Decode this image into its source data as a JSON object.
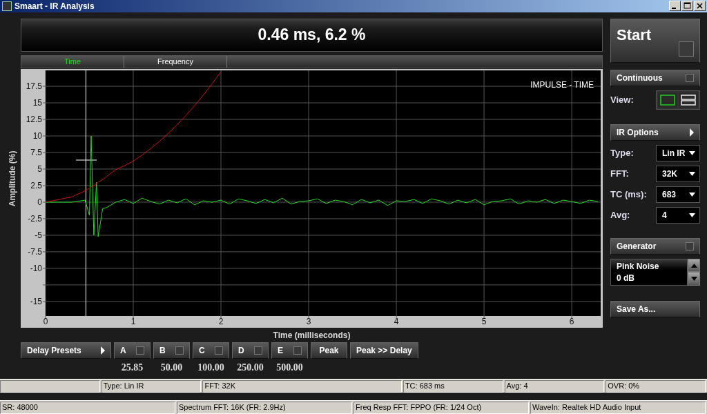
{
  "window": {
    "title": "Smaart - IR Analysis"
  },
  "readout": "0.46 ms, 6.2 %",
  "tabs": [
    {
      "label": "Time",
      "selected": true
    },
    {
      "label": "Frequency",
      "selected": false
    }
  ],
  "plot": {
    "chart_data": {
      "type": "line",
      "title": "IMPULSE - TIME",
      "xlabel": "Time (milliseconds)",
      "ylabel": "Amplitude (%)",
      "x": [
        0,
        0.3,
        0.45,
        0.5,
        0.52,
        0.55,
        0.58,
        0.6,
        0.65,
        0.7,
        0.8,
        0.9,
        1,
        1.1,
        1.2,
        1.3,
        1.4,
        1.5,
        1.6,
        1.7,
        1.8,
        1.9,
        2,
        2.1,
        2.2,
        2.3,
        2.4,
        2.5,
        2.6,
        2.7,
        2.8,
        2.9,
        3,
        3.1,
        3.2,
        3.3,
        3.4,
        3.5,
        3.6,
        3.7,
        3.8,
        3.9,
        4,
        4.1,
        4.2,
        4.3,
        4.4,
        4.5,
        4.6,
        4.7,
        4.8,
        4.9,
        5,
        5.1,
        5.2,
        5.3,
        5.4,
        5.5,
        5.6,
        5.7,
        5.8,
        5.9,
        6,
        6.1,
        6.2,
        6.3
      ],
      "series": [
        {
          "color": "#22dd22",
          "values": [
            0,
            0,
            0.3,
            -2,
            10,
            -5,
            3,
            -5.2,
            -1,
            -0.8,
            0,
            0.4,
            -0.2,
            0.6,
            0.1,
            -0.3,
            0.3,
            -0.1,
            0.5,
            -0.4,
            0.2,
            0,
            0.3,
            -0.3,
            0.5,
            0.2,
            -0.2,
            0.4,
            -0.1,
            0.6,
            -0.3,
            0.1,
            0.2,
            0.5,
            -0.2,
            0.3,
            0.1,
            -0.4,
            0.4,
            -0.1,
            0.3,
            -0.5,
            0.2,
            0.1,
            0.4,
            -0.2,
            0.5,
            0.2,
            -0.3,
            0.3,
            -0.1,
            0.4,
            -0.4,
            0.1,
            0.2,
            0.5,
            -0.3,
            0.2,
            0,
            0.4,
            -0.2,
            0.3,
            0.1,
            -0.2,
            0.3,
            0.1
          ]
        },
        {
          "color": "#cc1111",
          "values": [
            0,
            0.8,
            1.7,
            2.1,
            2.3,
            2.5,
            2.8,
            3,
            3.4,
            3.9,
            4.9,
            5.5,
            6.2,
            7.1,
            8.1,
            9.2,
            10.4,
            11.7,
            13.1,
            14.6,
            16.2,
            17.9,
            19.7,
            null,
            null,
            null,
            null,
            null,
            null,
            null,
            null,
            null,
            null,
            null,
            null,
            null,
            null,
            null,
            null,
            null,
            null,
            null,
            null,
            null,
            null,
            null,
            null,
            null,
            null,
            null,
            null,
            null,
            null,
            null,
            null,
            null,
            null,
            null,
            null,
            null,
            null,
            null,
            null,
            null,
            null,
            null
          ]
        }
      ],
      "xlim": [
        0,
        6.33
      ],
      "ylim": [
        -17.2,
        19.9
      ],
      "xticks": [
        0,
        1,
        2,
        3,
        4,
        5,
        6
      ],
      "yticks": [
        17.5,
        15,
        12.5,
        10,
        7.5,
        5,
        2.5,
        0,
        -2.5,
        -5,
        -7.5,
        -10,
        -15
      ],
      "grid": true,
      "ref_lines": [
        {
          "axis": "x",
          "value": 0.46
        }
      ]
    }
  },
  "side": {
    "start": {
      "label": "Start",
      "checked": false
    },
    "continuous": {
      "label": "Continuous",
      "checked": false
    },
    "view": {
      "label": "View:",
      "options": [
        {
          "kind": "single",
          "selected": true
        },
        {
          "kind": "split",
          "selected": false
        }
      ]
    },
    "ir_options": "IR Options",
    "settings": [
      {
        "label": "Type:",
        "value": "Lin IR"
      },
      {
        "label": "FFT:",
        "value": "32K"
      },
      {
        "label": "TC (ms):",
        "value": "683"
      },
      {
        "label": "Avg:",
        "value": "4"
      }
    ],
    "generator": {
      "label": "Generator",
      "checked": false
    },
    "signal": [
      "Pink Noise",
      "0 dB"
    ],
    "save": "Save As..."
  },
  "delay": {
    "presets": "Delay Presets",
    "slots": [
      {
        "label": "A",
        "checked": false,
        "value": "25.85"
      },
      {
        "label": "B",
        "checked": false,
        "value": "50.00"
      },
      {
        "label": "C",
        "checked": false,
        "value": "100.00"
      },
      {
        "label": "D",
        "checked": false,
        "value": "250.00"
      },
      {
        "label": "E",
        "checked": false,
        "value": "500.00"
      }
    ],
    "peak": "Peak",
    "peak_delay": "Peak >> Delay"
  },
  "status_bar": {
    "row1": [
      "Type: Lin IR",
      "FFT: 32K",
      "TC: 683 ms",
      "Avg: 4",
      "OVR: 0%"
    ],
    "row2": [
      "SR: 48000",
      "Spectrum FFT: 16K (FR: 2.9Hz)",
      "Freq Resp FFT: FPPO (FR: 1/24 Oct)",
      "WaveIn: Realtek HD Audio Input"
    ]
  }
}
